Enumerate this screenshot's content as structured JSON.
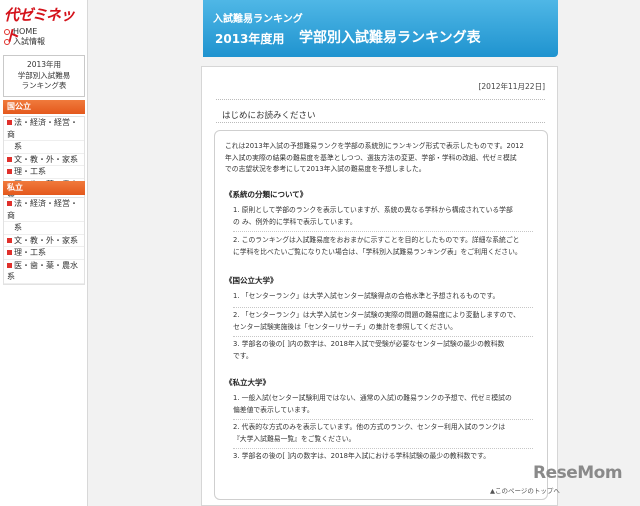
{
  "sidebar": {
    "logo": "代ゼミネット",
    "links": [
      "HOME",
      "入試情報"
    ],
    "year_box": [
      "2013年用",
      "学部別入試難易",
      "ランキング表"
    ],
    "national_head": "国公立",
    "national_items": [
      "法・経済・経営・商",
      "系",
      "文・教・外・家系",
      "理・工系",
      "医・歯・薬・農水系"
    ],
    "private_head": "私立",
    "private_items": [
      "法・経済・経営・商",
      "系",
      "文・教・外・家系",
      "理・工系",
      "医・歯・薬・農水系"
    ]
  },
  "banner": {
    "line1": "入試難易ランキング",
    "line2": "2013年度用",
    "line3": "学部別入試難易ランキング表"
  },
  "main": {
    "date": "[2012年11月22日]",
    "intro_title": "はじめにお読みください",
    "intro_text": [
      "これは2013年入試の予想難易ランクを学部の系統別にランキング形式で表示したものです。2012",
      "年入試の実際の結果の難易度を基準としつつ、選抜方法の変更、学部・学科の改組、代ゼミ模試",
      "での志望状況を参考にして2013年入試の難易度を予想しました。"
    ],
    "sec1_title": "《系統の分類について》",
    "sec1_items": [
      [
        "1. 原則として学部のランクを表示していますが、系統の異なる学科から構成されている学部",
        "の み、例外的に学科で表示しています。"
      ],
      [
        "2. このランキングは入試難易度をおおまかに示すことを目的としたものです。詳細な系統ごと",
        "に学科を比べたいご覧になりたい場合は、「学科別入試難易ランキング表」をご利用ください。"
      ]
    ],
    "sec2_title": "《国公立大学》",
    "sec2_items": [
      [
        "1. 「センターランク」は大学入試センター試験得点の合格水準と予想されるものです。"
      ],
      [
        "2. 「センターランク」は大学入試センター試験の実際の問題の難易度により変動しますので、",
        "センター試験実施後は「センターリサーチ」の集計を参照してください。"
      ],
      [
        "3. 学部名の後の[ ]内の数字は、2018年入試で受験が必要なセンター試験の最少の教科数",
        "です。"
      ]
    ],
    "sec3_title": "《私立大学》",
    "sec3_items": [
      [
        "1. 一般入試(センター試験利用ではない、通常の入試)の難易ランクの予想で、代ゼミ模試の",
        "偏差値で表示しています。"
      ],
      [
        "2. 代表的な方式のみを表示しています。他の方式のランク、センター利用入試のランクは",
        "『大学入試難易一覧』をご覧ください。"
      ],
      [
        "3. 学部名の後の[ ]内の数字は、2018年入試における学科試験の最少の教科数です。"
      ]
    ],
    "footer_link": "▲このページのトップへ",
    "watermark": "ReseMom"
  }
}
